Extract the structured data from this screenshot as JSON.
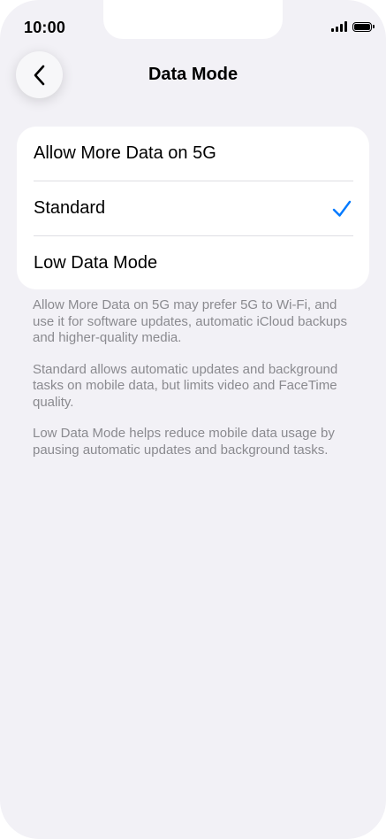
{
  "status_bar": {
    "time": "10:00"
  },
  "nav": {
    "title": "Data Mode",
    "back_icon": "chevron-left-icon"
  },
  "options": [
    {
      "label": "Allow More Data on 5G",
      "selected": false
    },
    {
      "label": "Standard",
      "selected": true
    },
    {
      "label": "Low Data Mode",
      "selected": false
    }
  ],
  "footer_notes": [
    "Allow More Data on 5G may prefer 5G to Wi-Fi, and use it for software updates, automatic iCloud backups and higher-quality media.",
    "Standard allows automatic updates and background tasks on mobile data, but limits video and FaceTime quality.",
    "Low Data Mode helps reduce mobile data usage by pausing automatic updates and background tasks."
  ],
  "colors": {
    "accent": "#007aff",
    "background": "#f2f1f6",
    "card": "#ffffff",
    "secondary_text": "#8a8a8f"
  }
}
